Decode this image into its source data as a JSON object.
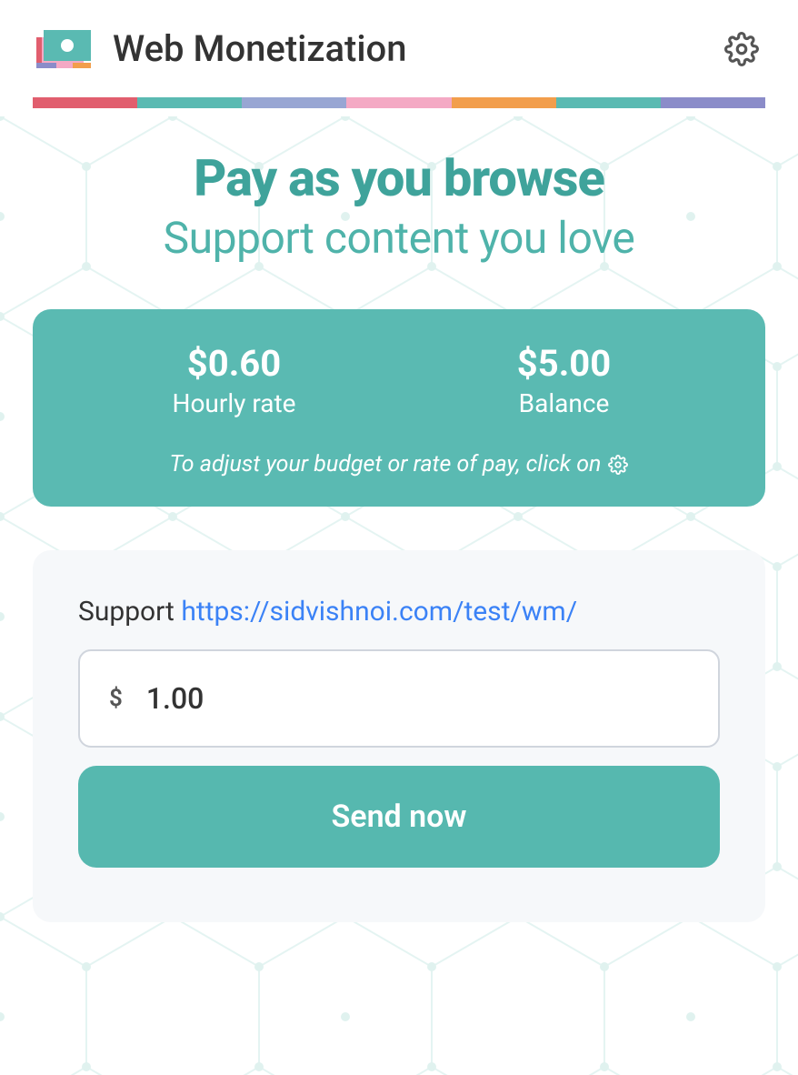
{
  "header": {
    "title": "Web Monetization"
  },
  "colorStrip": [
    "#e15e6e",
    "#5abab2",
    "#98a6d3",
    "#f4a9c4",
    "#f29e4c",
    "#5abab2",
    "#8b8cc9"
  ],
  "hero": {
    "title": "Pay as you browse",
    "subtitle": "Support content you love"
  },
  "stats": {
    "hourlyRate": {
      "value": "$0.60",
      "label": "Hourly rate"
    },
    "balance": {
      "value": "$5.00",
      "label": "Balance"
    },
    "hint": "To adjust your budget or rate of pay, click on"
  },
  "support": {
    "labelPrefix": "Support ",
    "url": "https://sidvishnoi.com/test/wm/",
    "currencySymbol": "$",
    "amount": "1.00",
    "sendButton": "Send now"
  }
}
